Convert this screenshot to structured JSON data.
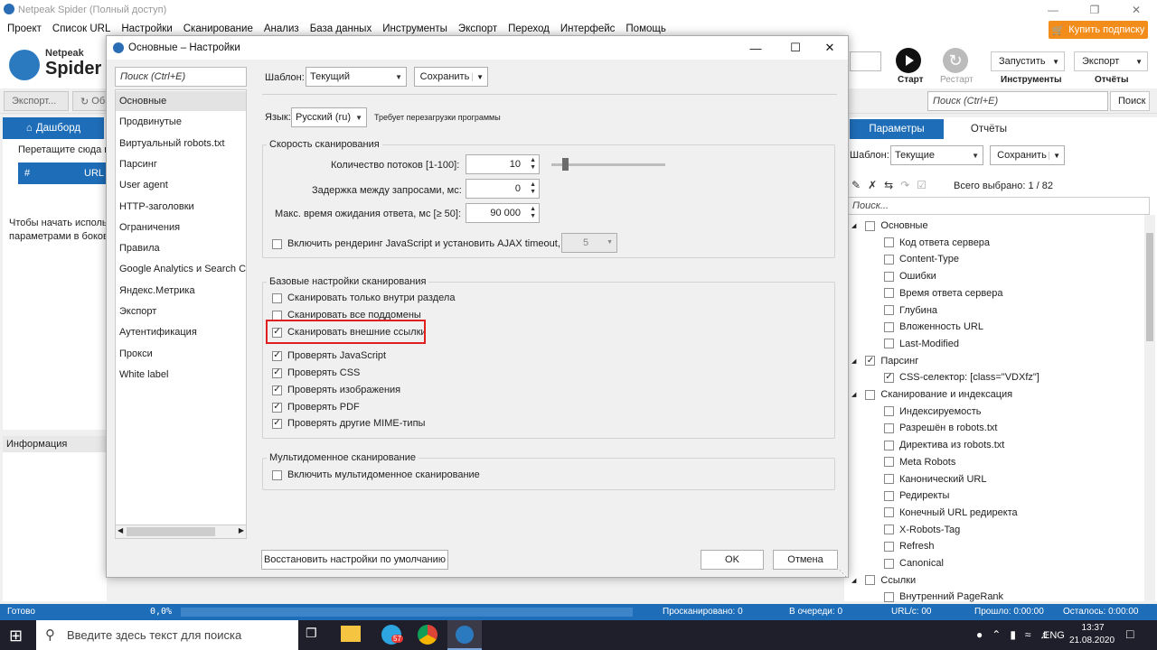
{
  "app": {
    "title": "Netpeak Spider (Полный доступ)",
    "menu": [
      "Проект",
      "Список URL",
      "Настройки",
      "Сканирование",
      "Анализ",
      "База данных",
      "Инструменты",
      "Экспорт",
      "Переход",
      "Интерфейс",
      "Помощь"
    ],
    "buy_label": "Купить подписку",
    "logo_small": "Netpeak",
    "logo_big": "Spider"
  },
  "toolbar": {
    "start_label": "Старт",
    "restart_label": "Рестарт",
    "run_label": "Запустить",
    "tools_label": "Инструменты",
    "export_label": "Экспорт",
    "reports_label": "Отчёты",
    "export_btn": "Экспорт...",
    "refresh_btn": "Обн",
    "search_placeholder": "Поиск (Ctrl+E)",
    "search_btn": "Поиск"
  },
  "left": {
    "dashboard_tab": "Дашборд",
    "drag_hint": "Перетащите сюда наз",
    "col_hash": "#",
    "col_url": "URL",
    "start_hint_1": "Чтобы начать исполь",
    "start_hint_2": "параметрами в боков",
    "info_label": "Информация"
  },
  "right": {
    "tab_params": "Параметры",
    "tab_reports": "Отчёты",
    "template_label": "Шаблон:",
    "template_value": "Текущие",
    "save_label": "Сохранить",
    "selected_label": "Всего выбрано: 1 / 82",
    "search_placeholder": "Поиск...",
    "tree": [
      {
        "label": "Основные",
        "level": 0,
        "checked": false
      },
      {
        "label": "Код ответа сервера",
        "level": 1,
        "checked": false
      },
      {
        "label": "Content-Type",
        "level": 1,
        "checked": false
      },
      {
        "label": "Ошибки",
        "level": 1,
        "checked": false
      },
      {
        "label": "Время ответа сервера",
        "level": 1,
        "checked": false
      },
      {
        "label": "Глубина",
        "level": 1,
        "checked": false
      },
      {
        "label": "Вложенность URL",
        "level": 1,
        "checked": false
      },
      {
        "label": "Last-Modified",
        "level": 1,
        "checked": false
      },
      {
        "label": "Парсинг",
        "level": 0,
        "checked": true
      },
      {
        "label": "CSS-селектор: [class=\"VDXfz\"]",
        "level": 1,
        "checked": true
      },
      {
        "label": "Сканирование и индексация",
        "level": 0,
        "checked": false
      },
      {
        "label": "Индексируемость",
        "level": 1,
        "checked": false
      },
      {
        "label": "Разрешён в robots.txt",
        "level": 1,
        "checked": false
      },
      {
        "label": "Директива из robots.txt",
        "level": 1,
        "checked": false
      },
      {
        "label": "Meta Robots",
        "level": 1,
        "checked": false
      },
      {
        "label": "Канонический URL",
        "level": 1,
        "checked": false
      },
      {
        "label": "Редиректы",
        "level": 1,
        "checked": false
      },
      {
        "label": "Конечный URL редиректа",
        "level": 1,
        "checked": false
      },
      {
        "label": "X-Robots-Tag",
        "level": 1,
        "checked": false
      },
      {
        "label": "Refresh",
        "level": 1,
        "checked": false
      },
      {
        "label": "Canonical",
        "level": 1,
        "checked": false
      },
      {
        "label": "Ссылки",
        "level": 0,
        "checked": false
      },
      {
        "label": "Внутренний PageRank",
        "level": 1,
        "checked": false
      }
    ]
  },
  "status": {
    "ready": "Готово",
    "percent": "0,0%",
    "scanned": "Просканировано: 0",
    "queue": "В очереди: 0",
    "urls": "URL/с: 00",
    "elapsed": "Прошло: 0:00:00",
    "remaining": "Осталось: 0:00:00"
  },
  "taskbar": {
    "search_placeholder": "Введите здесь текст для поиска",
    "lang": "ENG",
    "time": "13:37",
    "date": "21.08.2020",
    "telegram_badge": "57"
  },
  "dialog": {
    "title": "Основные – Настройки",
    "nav_search_placeholder": "Поиск (Ctrl+E)",
    "nav_items": [
      "Основные",
      "Продвинутые",
      "Виртуальный robots.txt",
      "Парсинг",
      "User agent",
      "HTTP-заголовки",
      "Ограничения",
      "Правила",
      "Google Analytics и Search Co",
      "Яндекс.Метрика",
      "Экспорт",
      "Аутентификация",
      "Прокси",
      "White label"
    ],
    "template_label": "Шаблон:",
    "template_value": "Текущий",
    "save_label": "Сохранить",
    "language_label": "Язык:",
    "language_value": "Русский (ru)",
    "language_note": "Требует перезагрузки программы",
    "speed_group": "Скорость сканирования",
    "threads_label": "Количество потоков [1-100]:",
    "threads_value": "10",
    "threads_level": 0.1,
    "delay_label": "Задержка между запросами, мс:",
    "delay_value": "0",
    "timeout_label": "Макс. время ожидания ответа, мс [≥ 50]:",
    "timeout_value": "90 000",
    "js_label": "Включить рендеринг JavaScript и установить AJAX timeout, с:",
    "js_value": "5",
    "basic_group": "Базовые настройки сканирования",
    "options": [
      {
        "label": "Сканировать только внутри раздела",
        "checked": false
      },
      {
        "label": "Сканировать все поддомены",
        "checked": false
      },
      {
        "label": "Сканировать внешние ссылки",
        "checked": true
      },
      {
        "label": "Проверять JavaScript",
        "checked": true
      },
      {
        "label": "Проверять CSS",
        "checked": true
      },
      {
        "label": "Проверять изображения",
        "checked": true
      },
      {
        "label": "Проверять PDF",
        "checked": true
      },
      {
        "label": "Проверять другие MIME-типы",
        "checked": true
      }
    ],
    "multi_group": "Мультидоменное сканирование",
    "multi_label": "Включить мультидоменное сканирование",
    "restore_label": "Восстановить настройки по умолчанию",
    "ok_label": "OK",
    "cancel_label": "Отмена"
  }
}
